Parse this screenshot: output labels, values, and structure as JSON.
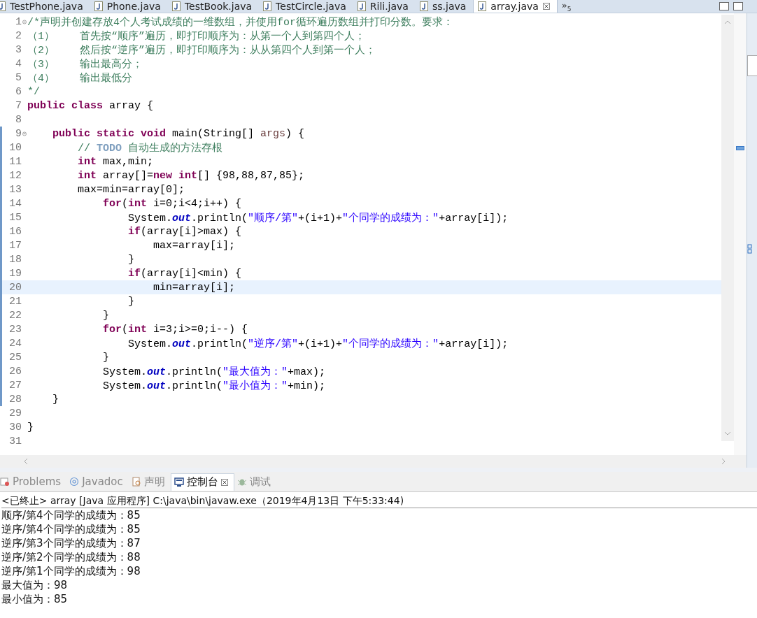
{
  "editor_tabs": [
    {
      "label": "TestPhone.java",
      "selected": false
    },
    {
      "label": "Phone.java",
      "selected": false
    },
    {
      "label": "TestBook.java",
      "selected": false
    },
    {
      "label": "TestCircle.java",
      "selected": false
    },
    {
      "label": "Rili.java",
      "selected": false
    },
    {
      "label": "ss.java",
      "selected": false
    },
    {
      "label": "array.java",
      "selected": true
    }
  ],
  "overflow_tabs": {
    "label": "»",
    "count": "5"
  },
  "code_lines": [
    {
      "number": "1",
      "foldable": true,
      "current": false,
      "tokens": [
        {
          "kind": "comment",
          "text": "/*声明并创建存放4个人考试成绩的一维数组，并使用for循环遍历数组并打印分数。要求："
        }
      ]
    },
    {
      "number": "2",
      "foldable": false,
      "current": false,
      "tokens": [
        {
          "kind": "comment",
          "text": "（1）    首先按“顺序”遍历，即打印顺序为：从第一个人到第四个人；"
        }
      ]
    },
    {
      "number": "3",
      "foldable": false,
      "current": false,
      "tokens": [
        {
          "kind": "comment",
          "text": "（2）    然后按“逆序”遍历，即打印顺序为：从从第四个人到第一个人；"
        }
      ]
    },
    {
      "number": "4",
      "foldable": false,
      "current": false,
      "tokens": [
        {
          "kind": "comment",
          "text": "（3）    输出最高分；"
        }
      ]
    },
    {
      "number": "5",
      "foldable": false,
      "current": false,
      "tokens": [
        {
          "kind": "comment",
          "text": "（4）    输出最低分"
        }
      ]
    },
    {
      "number": "6",
      "foldable": false,
      "current": false,
      "tokens": [
        {
          "kind": "comment",
          "text": "*/"
        }
      ]
    },
    {
      "number": "7",
      "foldable": false,
      "current": false,
      "tokens": [
        {
          "kind": "keyword",
          "text": "public class"
        },
        {
          "kind": "plain",
          "text": " array {"
        }
      ]
    },
    {
      "number": "8",
      "foldable": false,
      "current": false
    },
    {
      "number": "9",
      "foldable": true,
      "current": false,
      "tokens": [
        {
          "kind": "keyword",
          "text": "    public static void"
        },
        {
          "kind": "plain",
          "text": " main(String[] "
        },
        {
          "kind": "variable",
          "text": "args"
        },
        {
          "kind": "plain",
          "text": ") {"
        }
      ]
    },
    {
      "number": "10",
      "foldable": false,
      "current": false,
      "tokens": [
        {
          "kind": "comment",
          "text": "        // "
        },
        {
          "kind": "todo",
          "text": "TODO"
        },
        {
          "kind": "comment",
          "text": " 自动生成的方法存根"
        }
      ]
    },
    {
      "number": "11",
      "foldable": false,
      "current": false,
      "tokens": [
        {
          "kind": "keyword",
          "text": "        int"
        },
        {
          "kind": "plain",
          "text": " max,min;"
        }
      ]
    },
    {
      "number": "12",
      "foldable": false,
      "current": false,
      "tokens": [
        {
          "kind": "keyword",
          "text": "        int"
        },
        {
          "kind": "plain",
          "text": " array[]="
        },
        {
          "kind": "keyword",
          "text": "new int"
        },
        {
          "kind": "plain",
          "text": "[] {98,88,87,85};"
        }
      ]
    },
    {
      "number": "13",
      "foldable": false,
      "current": false,
      "tokens": [
        {
          "kind": "plain",
          "text": "        max=min=array[0];"
        }
      ]
    },
    {
      "number": "14",
      "foldable": false,
      "current": false,
      "tokens": [
        {
          "kind": "keyword",
          "text": "            for"
        },
        {
          "kind": "plain",
          "text": "("
        },
        {
          "kind": "keyword",
          "text": "int"
        },
        {
          "kind": "plain",
          "text": " i=0;i<4;i++) {"
        }
      ]
    },
    {
      "number": "15",
      "foldable": false,
      "current": false,
      "tokens": [
        {
          "kind": "plain",
          "text": "                System."
        },
        {
          "kind": "field",
          "text": "out"
        },
        {
          "kind": "plain",
          "text": ".println("
        },
        {
          "kind": "string",
          "text": "\"顺序/第\""
        },
        {
          "kind": "plain",
          "text": "+(i+1)+"
        },
        {
          "kind": "string",
          "text": "\"个同学的成绩为：\""
        },
        {
          "kind": "plain",
          "text": "+array[i]);"
        }
      ]
    },
    {
      "number": "16",
      "foldable": false,
      "current": false,
      "tokens": [
        {
          "kind": "keyword",
          "text": "                if"
        },
        {
          "kind": "plain",
          "text": "(array[i]>max) {"
        }
      ]
    },
    {
      "number": "17",
      "foldable": false,
      "current": false,
      "tokens": [
        {
          "kind": "plain",
          "text": "                    max=array[i];"
        }
      ]
    },
    {
      "number": "18",
      "foldable": false,
      "current": false,
      "tokens": [
        {
          "kind": "plain",
          "text": "                }"
        }
      ]
    },
    {
      "number": "19",
      "foldable": false,
      "current": false,
      "tokens": [
        {
          "kind": "keyword",
          "text": "                if"
        },
        {
          "kind": "plain",
          "text": "(array[i]<min) {"
        }
      ]
    },
    {
      "number": "20",
      "foldable": false,
      "current": true,
      "tokens": [
        {
          "kind": "plain",
          "text": "                    min=array[i];"
        }
      ]
    },
    {
      "number": "21",
      "foldable": false,
      "current": false,
      "tokens": [
        {
          "kind": "plain",
          "text": "                }"
        }
      ]
    },
    {
      "number": "22",
      "foldable": false,
      "current": false,
      "tokens": [
        {
          "kind": "plain",
          "text": "            }"
        }
      ]
    },
    {
      "number": "23",
      "foldable": false,
      "current": false,
      "tokens": [
        {
          "kind": "keyword",
          "text": "            for"
        },
        {
          "kind": "plain",
          "text": "("
        },
        {
          "kind": "keyword",
          "text": "int"
        },
        {
          "kind": "plain",
          "text": " i=3;i>=0;i--) {"
        }
      ]
    },
    {
      "number": "24",
      "foldable": false,
      "current": false,
      "tokens": [
        {
          "kind": "plain",
          "text": "                System."
        },
        {
          "kind": "field",
          "text": "out"
        },
        {
          "kind": "plain",
          "text": ".println("
        },
        {
          "kind": "string",
          "text": "\"逆序/第\""
        },
        {
          "kind": "plain",
          "text": "+(i+1)+"
        },
        {
          "kind": "string",
          "text": "\"个同学的成绩为：\""
        },
        {
          "kind": "plain",
          "text": "+array[i]);"
        }
      ]
    },
    {
      "number": "25",
      "foldable": false,
      "current": false,
      "tokens": [
        {
          "kind": "plain",
          "text": "            }"
        }
      ]
    },
    {
      "number": "26",
      "foldable": false,
      "current": false,
      "tokens": [
        {
          "kind": "plain",
          "text": "            System."
        },
        {
          "kind": "field",
          "text": "out"
        },
        {
          "kind": "plain",
          "text": ".println("
        },
        {
          "kind": "string",
          "text": "\"最大值为：\""
        },
        {
          "kind": "plain",
          "text": "+max);"
        }
      ]
    },
    {
      "number": "27",
      "foldable": false,
      "current": false,
      "tokens": [
        {
          "kind": "plain",
          "text": "            System."
        },
        {
          "kind": "field",
          "text": "out"
        },
        {
          "kind": "plain",
          "text": ".println("
        },
        {
          "kind": "string",
          "text": "\"最小值为：\""
        },
        {
          "kind": "plain",
          "text": "+min);"
        }
      ]
    },
    {
      "number": "28",
      "foldable": false,
      "current": false,
      "tokens": [
        {
          "kind": "plain",
          "text": "    }"
        }
      ]
    },
    {
      "number": "29",
      "foldable": false,
      "current": false
    },
    {
      "number": "30",
      "foldable": false,
      "current": false,
      "tokens": [
        {
          "kind": "plain",
          "text": "}"
        }
      ]
    },
    {
      "number": "31",
      "foldable": false,
      "current": false
    }
  ],
  "panel_tabs": [
    {
      "label": "Problems",
      "kind": "problems",
      "selected": false
    },
    {
      "label": "Javadoc",
      "kind": "javadoc",
      "selected": false
    },
    {
      "label": "声明",
      "kind": "declaration",
      "selected": false
    },
    {
      "label": "控制台",
      "kind": "console",
      "selected": true
    },
    {
      "label": "调试",
      "kind": "debug",
      "selected": false
    }
  ],
  "console": {
    "header": "<已终止> array [Java 应用程序] C:\\java\\bin\\javaw.exe（2019年4月13日 下午5:33:44)",
    "output": [
      "顺序/第4个同学的成绩为：85",
      "逆序/第4个同学的成绩为：85",
      "逆序/第3个同学的成绩为：87",
      "逆序/第2个同学的成绩为：88",
      "逆序/第1个同学的成绩为：98",
      "最大值为：98",
      "最小值为：85"
    ]
  }
}
